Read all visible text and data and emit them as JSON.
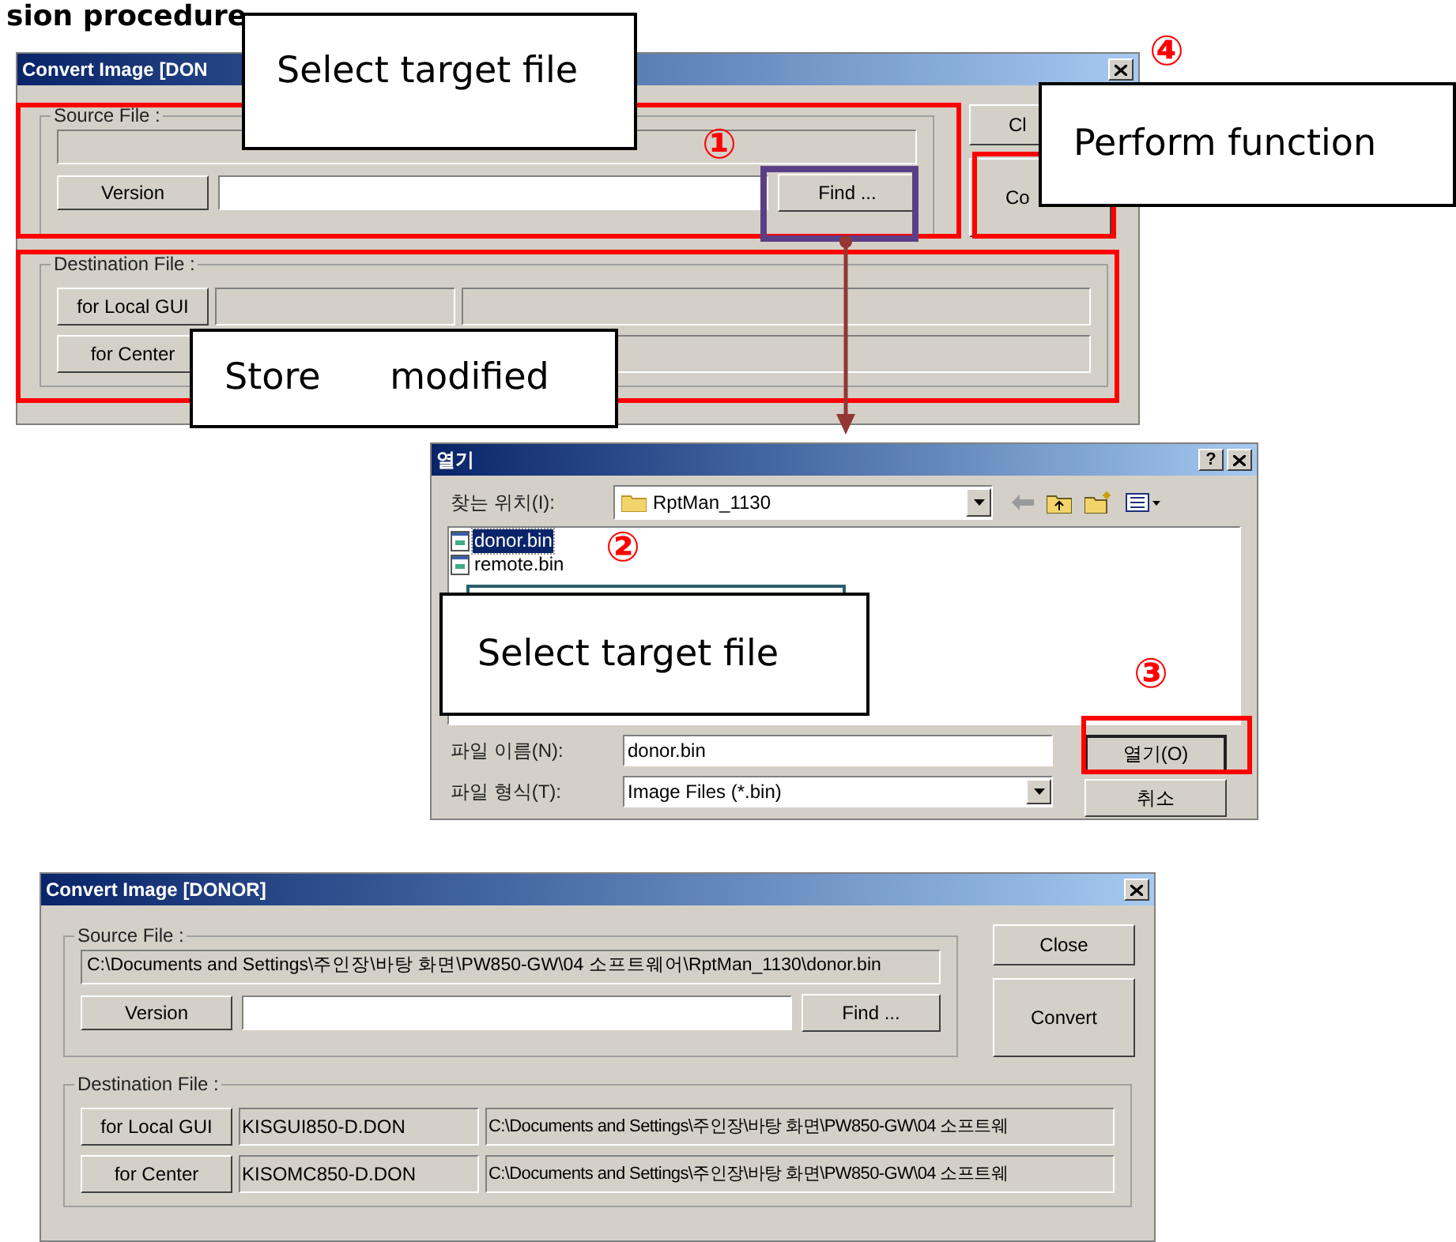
{
  "heading": "sion procedure",
  "convert_window_top": {
    "title": "Convert Image [DON",
    "source_label": "Source File :",
    "version_label": "Version",
    "find_button": "Find ...",
    "close_button": "Cl",
    "convert_button": "Co",
    "destination_label": "Destination File :",
    "destinations": [
      {
        "label": "for Local GUI"
      },
      {
        "label": "for Center"
      }
    ]
  },
  "open_dialog": {
    "title": "열기",
    "help_button": "?",
    "look_in_label": "찾는 위치(I):",
    "folder": "RptMan_1130",
    "files": [
      {
        "name": "donor.bin",
        "selected": true
      },
      {
        "name": "remote.bin",
        "selected": false
      }
    ],
    "file_name_label": "파일 이름(N):",
    "file_name": "donor.bin",
    "file_type_label": "파일 형식(T):",
    "file_type": "Image Files (*.bin)",
    "open_button": "열기(O)",
    "cancel_button": "취소"
  },
  "convert_window": {
    "title": "Convert Image [DONOR]",
    "source_label": "Source File :",
    "source_path": "C:\\Documents and Settings\\주인장\\바탕 화면\\PW850-GW\\04 소프트웨어\\RptMan_1130\\donor.bin",
    "version_label": "Version",
    "find_button": "Find ...",
    "close_button": "Close",
    "convert_button": "Convert",
    "destination_label": "Destination File :",
    "destinations": [
      {
        "label": "for Local GUI",
        "file": "KISGUI850-D.DON",
        "path": "C:\\Documents and Settings\\주인장\\바탕 화면\\PW850-GW\\04 소프트웨"
      },
      {
        "label": "for Center",
        "file": "KISOMC850-D.DON",
        "path": "C:\\Documents and Settings\\주인장\\바탕 화면\\PW850-GW\\04 소프트웨"
      }
    ]
  },
  "callouts": [
    "Select target file",
    "Perform function",
    "Store      modified",
    "Select target file"
  ],
  "step_markers": [
    "①",
    "②",
    "③",
    "④"
  ]
}
